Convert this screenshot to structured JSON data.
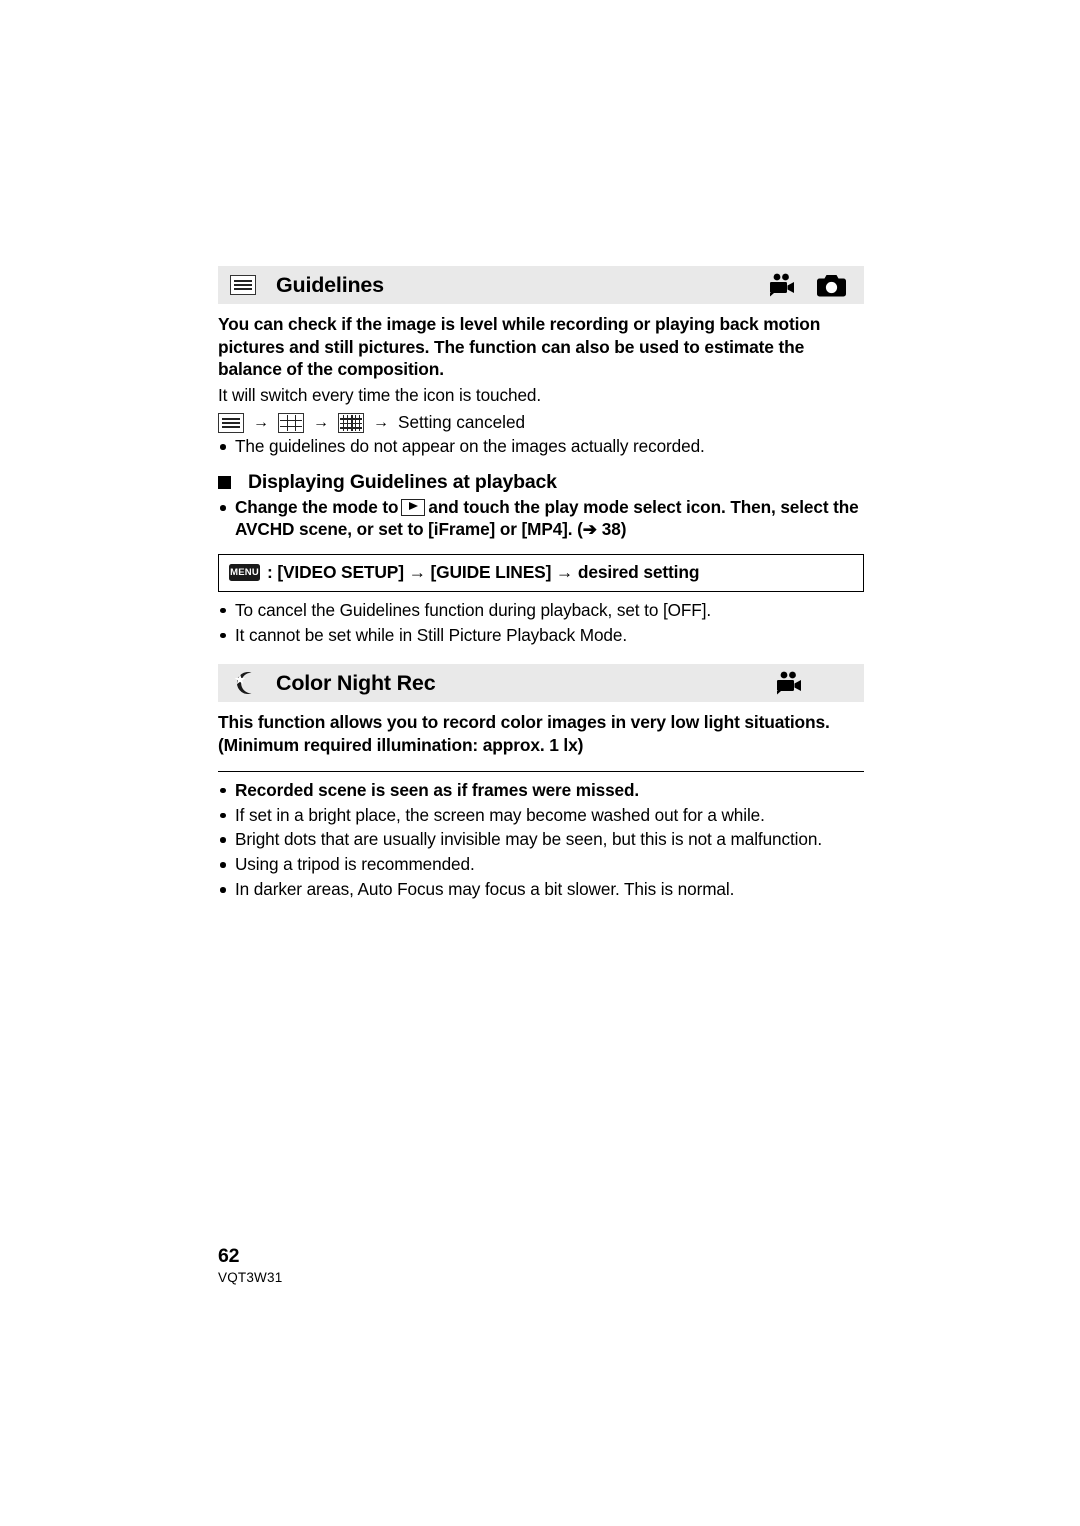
{
  "page": {
    "number": "62",
    "document_code": "VQT3W31"
  },
  "sections": [
    {
      "id": "guidelines",
      "header": {
        "icon": "guidelines-lines-icon",
        "title": "Guidelines",
        "mode_icons": [
          "video-camera-icon",
          "still-camera-icon"
        ]
      },
      "intro_bold": "You can check if the image is level while recording or playing back motion pictures and still pictures. The function can also be used to estimate the balance of the composition.",
      "intro_plain": "It will switch every time the icon is touched.",
      "flow": {
        "icons": [
          "guidelines-lines-icon",
          "grid-3x3-icon",
          "grid-fine-icon"
        ],
        "arrow": "→",
        "end_label": "Setting canceled"
      },
      "notes": [
        "The guidelines do not appear on the images actually recorded."
      ],
      "subsection": {
        "heading": "Displaying Guidelines at playback",
        "bullets_bold": [
          "Change the mode to  ▶  and touch the play mode select icon. Then, select the AVCHD scene, or set to [iFrame] or [MP4]. (→ 38)"
        ],
        "bullet_bold_part1": "Change the mode to",
        "bullet_bold_part2": "and touch the play mode select icon. Then, select the AVCHD scene, or set to [iFrame] or [MP4]. (",
        "bullet_bold_arrow": "➔",
        "bullet_bold_part3": "38)",
        "menu_box": {
          "chip": "MENU",
          "path": ": [VIDEO SETUP] → [GUIDE LINES] → desired setting"
        },
        "notes": [
          "To cancel the Guidelines function during playback, set to [OFF].",
          "It cannot be set while in Still Picture Playback Mode."
        ]
      }
    },
    {
      "id": "color-night-rec",
      "header": {
        "icon": "moon-star-icon",
        "title": "Color Night Rec",
        "mode_icons": [
          "video-camera-icon"
        ]
      },
      "intro_bold": "This function allows you to record color images in very low light situations. (Minimum required illumination: approx. 1 lx)",
      "notes": [
        {
          "text": "Recorded scene is seen as if frames were missed.",
          "bold": true
        },
        {
          "text": "If set in a bright place, the screen may become washed out for a while.",
          "bold": false
        },
        {
          "text": "Bright dots that are usually invisible may be seen, but this is not a malfunction.",
          "bold": false
        },
        {
          "text": "Using a tripod is recommended.",
          "bold": false
        },
        {
          "text": "In darker areas, Auto Focus may focus a bit slower. This is normal.",
          "bold": false
        }
      ]
    }
  ],
  "colors": {
    "section_bar_bg": "#e9e9e9",
    "text": "#000000",
    "page_bg": "#ffffff"
  }
}
